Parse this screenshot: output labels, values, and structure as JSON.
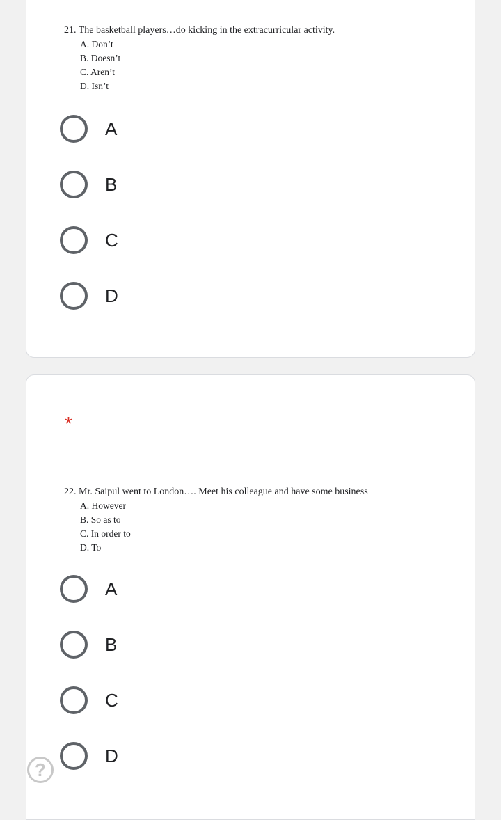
{
  "questions": [
    {
      "stem": "21. The basketball players…do kicking in the extracurricular activity.",
      "options": [
        "A.  Don’t",
        "B.  Doesn’t",
        "C.  Aren’t",
        "D.  Isn’t"
      ],
      "choices": [
        "A",
        "B",
        "C",
        "D"
      ]
    },
    {
      "required_marker": "*",
      "stem": "22. Mr. Saipul went to London…. Meet his colleague and have some business",
      "options": [
        "A.  However",
        "B.  So as to",
        "C.  In order to",
        "D.  To"
      ],
      "choices": [
        "A",
        "B",
        "C",
        "D"
      ]
    }
  ],
  "help": {
    "glyph": "?",
    "icon": "help-circle-icon"
  },
  "colors": {
    "background": "#f1f1f1",
    "card": "#ffffff",
    "card_border": "#dadce0",
    "radio_border": "#5f6368",
    "required": "#d93025"
  }
}
